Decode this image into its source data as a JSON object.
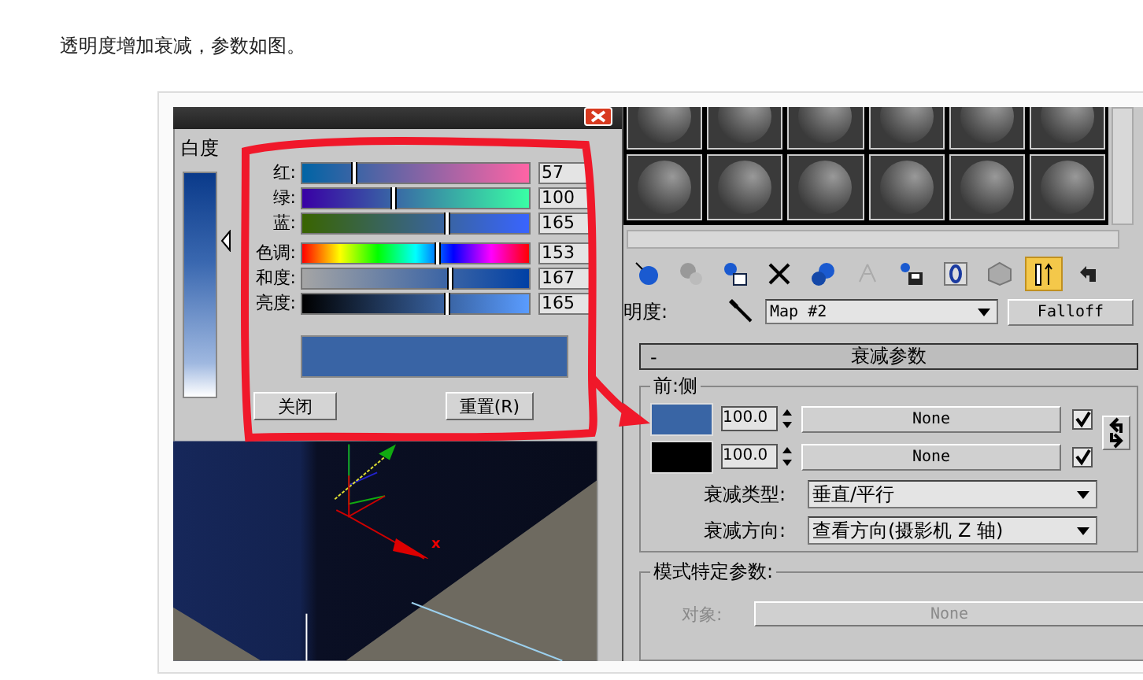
{
  "caption": "透明度增加衰减，参数如图。",
  "color_picker": {
    "whiteness": {
      "label": "白度",
      "level": 0.25
    },
    "sliders": [
      {
        "kind": "red",
        "label": "红:",
        "value": "57",
        "level": 0.23
      },
      {
        "kind": "green",
        "label": "绿:",
        "value": "100",
        "level": 0.4
      },
      {
        "kind": "blue",
        "label": "蓝:",
        "value": "165",
        "level": 0.64
      },
      {
        "kind": "hue",
        "label": "色调:",
        "value": "153",
        "level": 0.6
      },
      {
        "kind": "saturation",
        "label": "和度:",
        "value": "167",
        "level": 0.65
      },
      {
        "kind": "brightness",
        "label": "亮度:",
        "value": "165",
        "level": 0.64
      }
    ],
    "buttons": [
      "关闭",
      "重置(R)"
    ]
  },
  "viewport": {
    "axis_label": "x"
  },
  "material_editor": {
    "toolbar": [
      {
        "kind": "get-material",
        "selected": false
      },
      {
        "kind": "put-to-scene",
        "selected": false
      },
      {
        "kind": "assign",
        "selected": false
      },
      {
        "kind": "reset",
        "selected": false
      },
      {
        "kind": "make-copy",
        "selected": false
      },
      {
        "kind": "unique",
        "selected": false
      },
      {
        "kind": "put-library",
        "selected": false
      },
      {
        "kind": "effects-channel",
        "selected": false
      },
      {
        "kind": "show-map",
        "selected": false
      },
      {
        "kind": "end-result",
        "selected": true
      },
      {
        "kind": "go-parent",
        "selected": false
      }
    ],
    "map_row": {
      "label": "明度:",
      "map_name": "Map #2",
      "map_type": "Falloff"
    },
    "rollout": {
      "toggle": "-",
      "title": "衰减参数"
    },
    "front_side": {
      "title": "前:侧",
      "rows": [
        {
          "color": "#3965a5",
          "amount": "100.0",
          "map": "None",
          "checked": true
        },
        {
          "color": "#000000",
          "amount": "100.0",
          "map": "None",
          "checked": true
        }
      ]
    },
    "falloff_type": {
      "label": "衰减类型:",
      "value": "垂直/平行"
    },
    "falloff_direction": {
      "label": "衰减方向:",
      "value": "查看方向(摄影机 Z 轴)"
    },
    "mode": {
      "title": "模式特定参数:",
      "object_label": "对象:",
      "object_button": "None",
      "disabled": true
    }
  }
}
